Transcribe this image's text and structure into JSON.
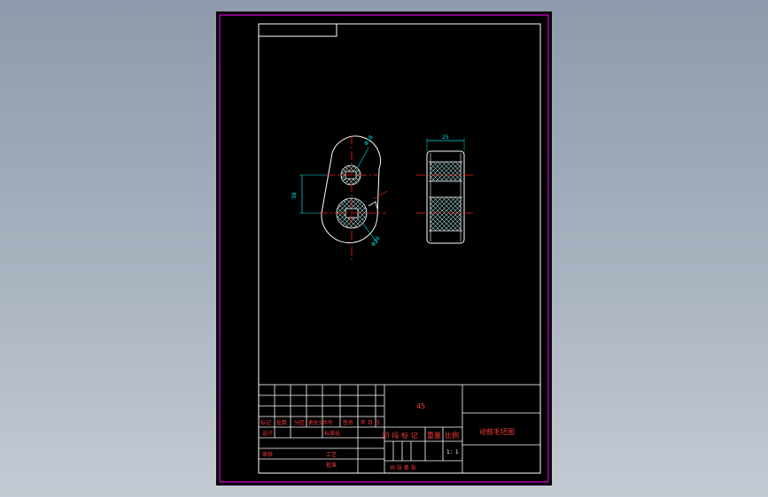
{
  "drawing": {
    "material": "45",
    "part_name": "动鼓毛坯图",
    "scale_value": "1：1",
    "colors": {
      "background": "#000000",
      "border": "#ff00ff",
      "frame": "#ffffff",
      "centerline": "#ff2020",
      "dimension": "#00e5e5",
      "title_text": "#ff3b3b",
      "hatch": "#9fd8d8"
    },
    "dimensions": {
      "front_width": "25",
      "hole_small": "Φ18",
      "hole_large": "Φ36",
      "center_distance": "38"
    }
  },
  "title_block": {
    "revision_headers": [
      "标记",
      "处数",
      "分区",
      "更改文件号",
      "签名",
      "年 月 日"
    ],
    "design": "设计",
    "standardize": "标准化",
    "review": "审核",
    "craft": "工艺",
    "approve": "批准",
    "stage_label": "阶 段 标 记",
    "weight_label": "重量",
    "scale_label": "比例",
    "sheets_label": "共    张    第    张"
  }
}
